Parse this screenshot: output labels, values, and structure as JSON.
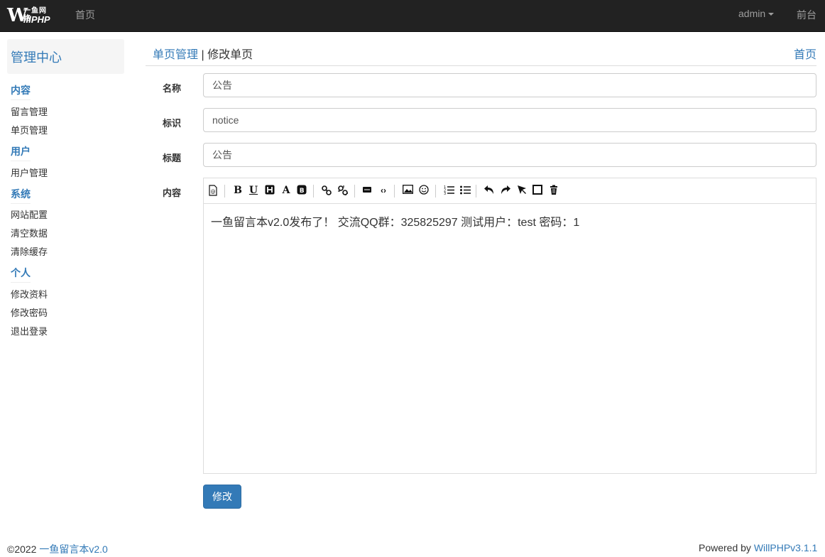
{
  "navbar": {
    "logo_letter": "W",
    "logo_cn": "一鱼网络",
    "logo_php": "illPHP",
    "home": "首页",
    "user": "admin",
    "front": "前台"
  },
  "sidebar": {
    "title": "管理中心",
    "sections": [
      {
        "title": "内容",
        "items": [
          "留言管理",
          "单页管理"
        ]
      },
      {
        "title": "用户",
        "items": [
          "用户管理"
        ]
      },
      {
        "title": "系统",
        "items": [
          "网站配置",
          "清空数据",
          "清除缓存"
        ]
      },
      {
        "title": "个人",
        "items": [
          "修改资料",
          "修改密码",
          "退出登录"
        ]
      }
    ]
  },
  "header": {
    "crumb_link": "单页管理",
    "crumb_sep": " | ",
    "crumb_current": "修改单页",
    "home_link": "首页"
  },
  "form": {
    "name_label": "名称",
    "name_value": "公告",
    "ident_label": "标识",
    "ident_value": "notice",
    "title_label": "标题",
    "title_value": "公告",
    "content_label": "内容",
    "content_value": "一鱼留言本v2.0发布了！ 交流QQ群：325825297 测试用户：test 密码：1",
    "submit": "修改"
  },
  "toolbar_icons": [
    "source-icon",
    "bold-icon",
    "underline-icon",
    "heading-icon",
    "font-color-icon",
    "bg-color-icon",
    "link-icon",
    "unlink-icon",
    "hr-icon",
    "code-icon",
    "image-icon",
    "emoticon-icon",
    "ordered-list-icon",
    "unordered-list-icon",
    "undo-icon",
    "redo-icon",
    "select-icon",
    "fullscreen-icon",
    "clear-icon"
  ],
  "footer": {
    "copyright": "©2022 ",
    "site_link": "一鱼留言本v2.0",
    "powered": "Powered by ",
    "powered_link": "WillPHPv3.1.1"
  }
}
